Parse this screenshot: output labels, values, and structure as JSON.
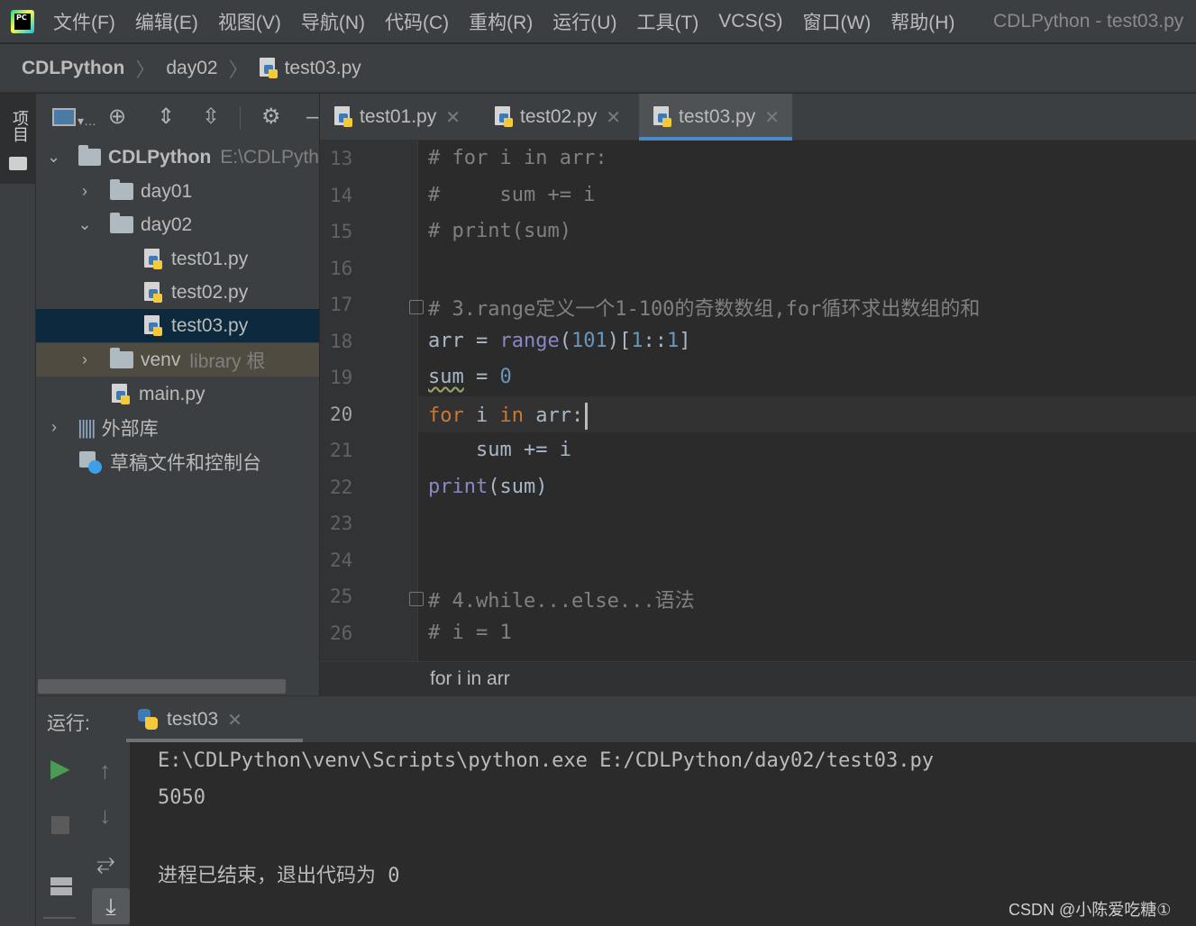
{
  "menubar": {
    "logo_text": "PC",
    "items": [
      "文件(F)",
      "编辑(E)",
      "视图(V)",
      "导航(N)",
      "代码(C)",
      "重构(R)",
      "运行(U)",
      "工具(T)",
      "VCS(S)",
      "窗口(W)",
      "帮助(H)"
    ],
    "window_title": "CDLPython - test03.py"
  },
  "breadcrumb": {
    "project": "CDLPython",
    "folder": "day02",
    "file": "test03.py"
  },
  "stripe": {
    "project_tab": "项目"
  },
  "project_tree": {
    "root_name": "CDLPython",
    "root_path": "E:\\CDLPyth",
    "day01": "day01",
    "day02": "day02",
    "files": [
      "test01.py",
      "test02.py",
      "test03.py"
    ],
    "venv": "venv",
    "venv_note": "library 根",
    "main": "main.py",
    "ext_libs": "外部库",
    "scratches": "草稿文件和控制台"
  },
  "tabs": [
    {
      "label": "test01.py",
      "active": false
    },
    {
      "label": "test02.py",
      "active": false
    },
    {
      "label": "test03.py",
      "active": true
    }
  ],
  "editor": {
    "line_numbers": [
      "13",
      "14",
      "15",
      "16",
      "17",
      "18",
      "19",
      "20",
      "21",
      "22",
      "23",
      "24",
      "25",
      "26"
    ],
    "current_line": "20",
    "code": {
      "l13": "# for i in arr:",
      "l14": "#     sum += i",
      "l15": "# print(sum)",
      "l17": "# 3.range定义一个1-100的奇数数组,for循环求出数组的和",
      "l18_a": "arr = ",
      "l18_b": "range",
      "l18_c": "(",
      "l18_d": "101",
      "l18_e": ")[",
      "l18_f": "1",
      "l18_g": "::",
      "l18_h": "1",
      "l18_i": "]",
      "l19_a": "sum",
      "l19_b": " = ",
      "l19_c": "0",
      "l20_a": "for",
      "l20_b": " i ",
      "l20_c": "in",
      "l20_d": " arr:",
      "l21": "    sum += i",
      "l22_a": "print",
      "l22_b": "(sum)",
      "l25": "# 4.while...else...语法",
      "l26": "# i = 1"
    },
    "breadcrumb": "for i in arr"
  },
  "run": {
    "label": "运行:",
    "tab": "test03",
    "output": [
      "E:\\CDLPython\\venv\\Scripts\\python.exe E:/CDLPython/day02/test03.py",
      "5050",
      "",
      "进程已结束，退出代码为 0"
    ]
  },
  "watermark": "CSDN @小陈爱吃糖①",
  "colors": {
    "keyword": "#cc7832",
    "builtin": "#8888c6",
    "number": "#6897bb",
    "comment": "#808080",
    "selection": "#0d293e",
    "accent": "#4a88c7",
    "run_green": "#499c54"
  }
}
